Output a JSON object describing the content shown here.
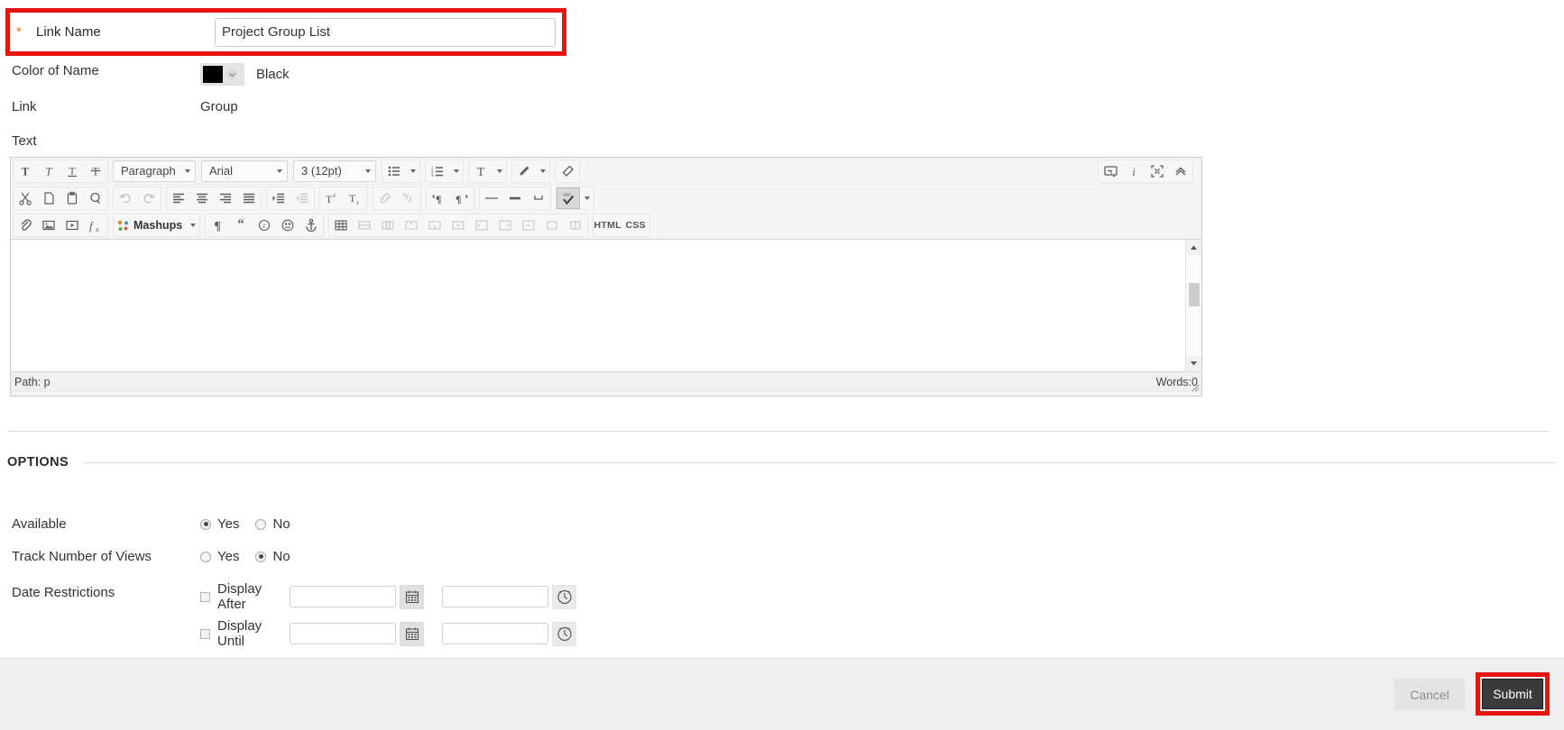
{
  "form": {
    "link_name": {
      "label": "Link Name",
      "required_marker": "*",
      "value": "Project Group List",
      "placeholder": ""
    },
    "color_of_name": {
      "label": "Color of Name",
      "swatch_color": "#000000",
      "value": "Black"
    },
    "link": {
      "label": "Link",
      "value": "Group"
    },
    "text": {
      "label": "Text"
    }
  },
  "editor": {
    "row1": {
      "format_buttons": [
        {
          "name": "bold-icon",
          "glyph": "T"
        },
        {
          "name": "italic-icon",
          "glyph": "T"
        },
        {
          "name": "underline-icon",
          "glyph": "T"
        },
        {
          "name": "strikethrough-icon",
          "glyph": "T"
        }
      ],
      "paragraph_select": "Paragraph",
      "font_select": "Arial",
      "size_select": "3 (12pt)",
      "list_buttons": [
        "bulleted-list-icon",
        "numbered-list-icon"
      ],
      "color_buttons": [
        "text-color-icon",
        "highlight-color-icon"
      ],
      "eraser": "remove-formatting-icon"
    },
    "row2": {
      "buttons": [
        "cut-icon",
        "copy-icon",
        "paste-icon",
        "find-replace-icon",
        "undo-icon",
        "redo-icon",
        "align-left-icon",
        "align-center-icon",
        "align-right-icon",
        "align-justify-icon",
        "indent-icon",
        "outdent-icon",
        "superscript-icon",
        "subscript-icon",
        "insert-link-icon",
        "unlink-icon",
        "ltr-icon",
        "rtl-icon",
        "horizontal-rule-icon",
        "line-icon",
        "nonbreaking-space-icon",
        "spellcheck-icon"
      ]
    },
    "row3": {
      "buttons": [
        "attach-file-icon",
        "insert-image-icon",
        "insert-media-icon",
        "math-formula-icon"
      ],
      "mashups_label": "Mashups",
      "more_buttons": [
        "show-invisibles-icon",
        "blockquote-icon",
        "copyright-icon",
        "emoticon-icon",
        "anchor-icon",
        "insert-table-icon",
        "table-row-props-icon",
        "table-cell-props-icon",
        "insert-row-before-icon",
        "insert-row-after-icon",
        "delete-row-icon",
        "insert-col-before-icon",
        "insert-col-after-icon",
        "delete-col-icon",
        "merge-cells-icon",
        "split-cell-icon"
      ],
      "html_label": "HTML",
      "css_label": "CSS"
    },
    "right_buttons": [
      "preview-icon",
      "info-icon",
      "fullscreen-icon",
      "collapse-toolbar-icon"
    ],
    "content": "",
    "status": {
      "path_label": "Path: p",
      "words_label": "Words:0"
    }
  },
  "options": {
    "section_title": "OPTIONS",
    "available": {
      "label": "Available",
      "yes_label": "Yes",
      "no_label": "No",
      "selected": "Yes"
    },
    "track_views": {
      "label": "Track Number of Views",
      "yes_label": "Yes",
      "no_label": "No",
      "selected": "No"
    },
    "date_restrictions": {
      "label": "Date Restrictions",
      "display_after": {
        "checkbox_label": "Display After",
        "checked": false,
        "date_value": "",
        "time_value": "",
        "date_icon": "calendar-icon",
        "time_icon": "clock-icon"
      },
      "display_until": {
        "checkbox_label": "Display Until",
        "checked": false,
        "date_value": "",
        "time_value": "",
        "date_icon": "calendar-icon",
        "time_icon": "clock-icon"
      }
    }
  },
  "footer": {
    "cancel_label": "Cancel",
    "submit_label": "Submit"
  },
  "highlight_color": "#e8150f"
}
